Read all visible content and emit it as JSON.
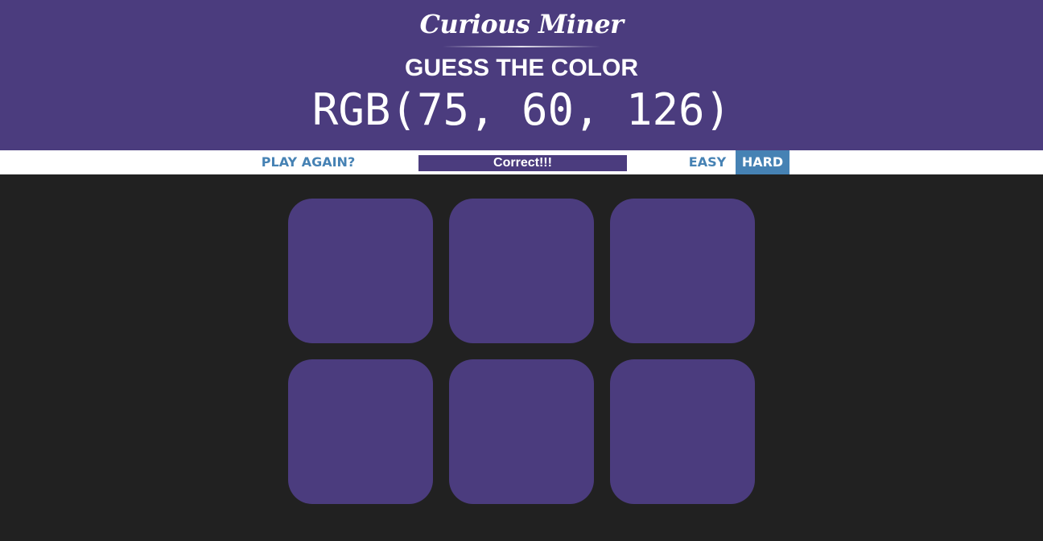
{
  "header": {
    "brand": "Curious Miner",
    "subtitle": "GUESS THE COLOR",
    "target_color": "RGB(75, 60, 126)"
  },
  "controls": {
    "play_again_label": "PLAY AGAIN?",
    "message": "Correct!!!",
    "easy_label": "EASY",
    "hard_label": "HARD",
    "selected_mode": "HARD"
  },
  "squares": [
    {
      "color": "#4b3c7e"
    },
    {
      "color": "#4b3c7e"
    },
    {
      "color": "#4b3c7e"
    },
    {
      "color": "#4b3c7e"
    },
    {
      "color": "#4b3c7e"
    },
    {
      "color": "#4b3c7e"
    }
  ],
  "colors": {
    "header_background": "#4b3c7e",
    "page_background": "#212121",
    "button_accent": "#4682b4",
    "stripe_background": "#ffffff"
  }
}
